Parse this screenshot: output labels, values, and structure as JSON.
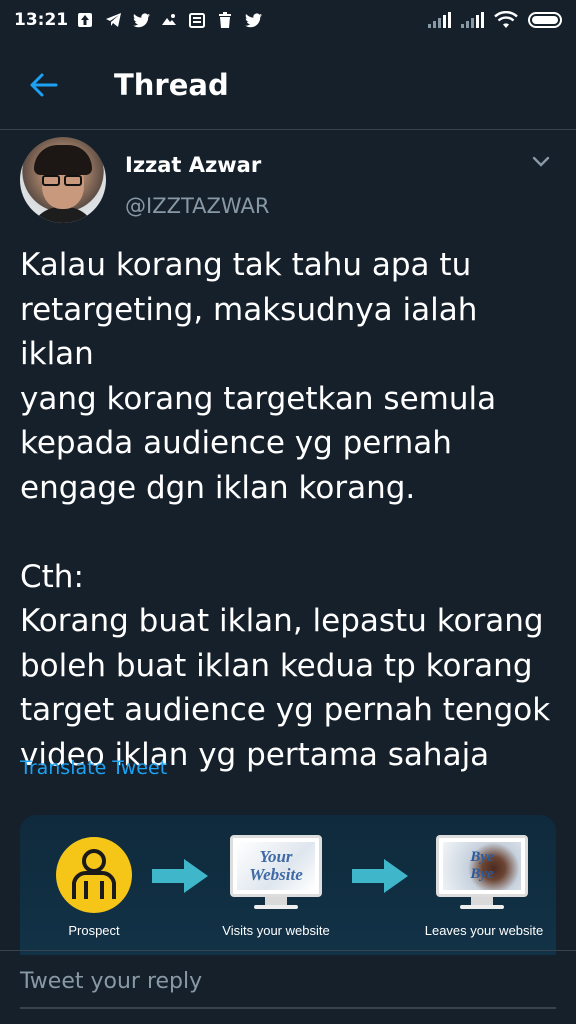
{
  "status_bar": {
    "time": "13:21",
    "left_icons": [
      "upload-icon",
      "telegram-icon",
      "twitter-icon",
      "weather-icon",
      "news-icon",
      "trash-icon",
      "twitter-icon"
    ],
    "right_icons": [
      "signal-icon",
      "signal-icon",
      "wifi-icon",
      "battery-icon"
    ]
  },
  "header": {
    "title": "Thread",
    "accent_color": "#1da1f2"
  },
  "tweet": {
    "author_name": "Izzat Azwar",
    "author_handle": "@IZZTAZWAR",
    "text": "Kalau korang tak tahu apa tu\nretargeting, maksudnya ialah iklan\nyang korang targetkan semula\nkepada audience yg pernah\nengage dgn iklan korang.\n\nCth:\nKorang buat iklan, lepastu korang\nboleh buat iklan kedua tp korang\ntarget audience yg pernah tengok\nvideo iklan yg pertama sahaja",
    "translate_label": "Translate Tweet"
  },
  "media": {
    "stages": [
      {
        "label": "Prospect",
        "icon": "person-icon"
      },
      {
        "label": "Visits your website",
        "screen_text": "Your Website",
        "icon": "monitor-icon"
      },
      {
        "label": "Leaves your website",
        "screen_text": "Bye Bye",
        "icon": "monitor-icon"
      }
    ]
  },
  "reply": {
    "placeholder": "Tweet your reply"
  }
}
